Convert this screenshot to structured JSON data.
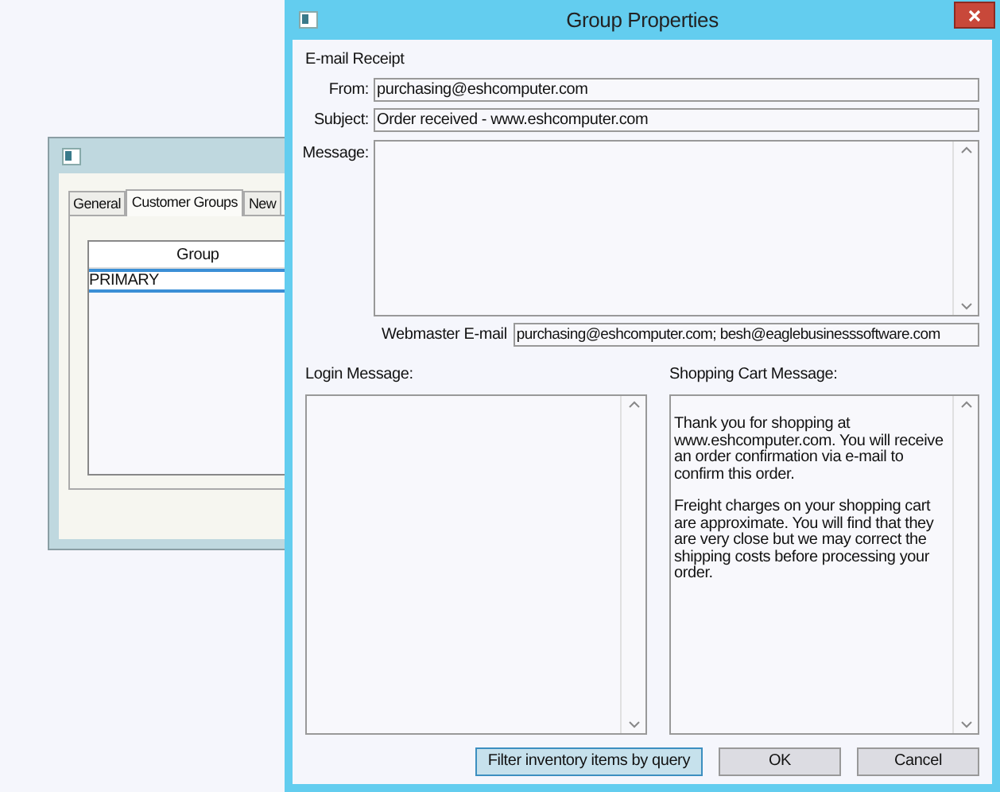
{
  "background_window": {
    "tabs": [
      {
        "label": "General",
        "selected": false
      },
      {
        "label": "Customer Groups",
        "selected": true
      },
      {
        "label": "New",
        "selected": false
      }
    ],
    "table": {
      "columns": [
        "Group"
      ],
      "rows": [
        {
          "cells": [
            "PRIMARY"
          ],
          "selected": true
        }
      ]
    }
  },
  "dialog": {
    "title": "Group Properties",
    "section": "E-mail Receipt",
    "fields": [
      {
        "label": "From:",
        "value": "purchasing@eshcomputer.com"
      },
      {
        "label": "Subject:",
        "value": "Order received - www.eshcomputer.com"
      }
    ],
    "message": {
      "label": "Message:"
    },
    "webmaster": {
      "label": "Webmaster E-mail",
      "value": "purchasing@eshcomputer.com; besh@eaglebusinesssoftware.com"
    },
    "login_message": {
      "label": "Login Message:"
    },
    "cart_message": {
      "label": "Shopping Cart Message:",
      "paragraphs": [
        "Thank you for shopping at www.eshcomputer.com. You will receive an order confirmation via e-mail to confirm this order.",
        "Freight charges on your shopping cart are approximate. You will find that they are very close but we may correct the shipping costs before processing your order."
      ]
    },
    "buttons": [
      {
        "label": "Filter inventory items by query",
        "selected": true
      },
      {
        "label": "OK",
        "selected": false
      },
      {
        "label": "Cancel",
        "selected": false
      }
    ]
  }
}
